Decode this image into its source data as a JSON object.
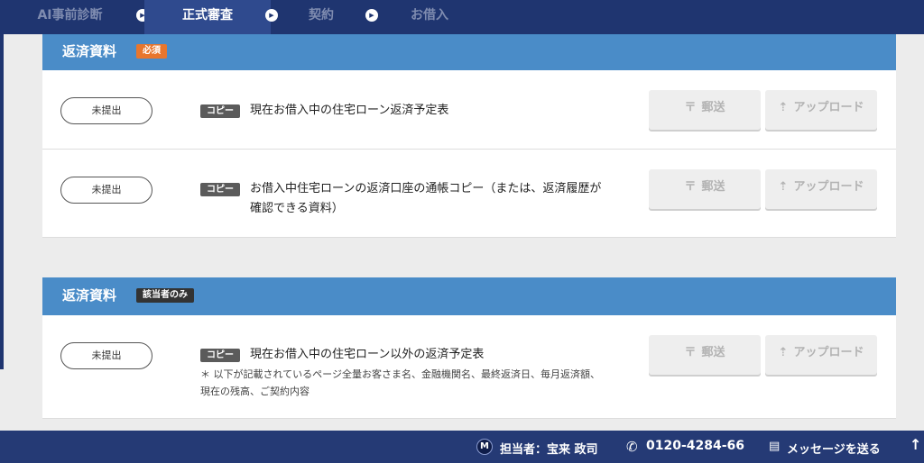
{
  "steps": [
    {
      "label": "AI事前診断"
    },
    {
      "label": "正式審査"
    },
    {
      "label": "契約"
    },
    {
      "label": "お借入"
    }
  ],
  "active_step": "正式審査",
  "panels": [
    {
      "title": "返済資料",
      "badge": "必須",
      "rows": [
        {
          "status": "未提出",
          "tag": "コピー",
          "title": "現在お借入中の住宅ローン返済予定表",
          "mail_label": "郵送",
          "upload_label": "アップロード"
        },
        {
          "status": "未提出",
          "tag": "コピー",
          "title": "お借入中住宅ローンの返済口座の通帳コピー（または、返済履歴が確認できる資料）",
          "mail_label": "郵送",
          "upload_label": "アップロード"
        }
      ]
    },
    {
      "title": "返済資料",
      "badge": "該当者のみ",
      "rows": [
        {
          "status": "未提出",
          "tag": "コピー",
          "title": "現在お借入中の住宅ローン以外の返済予定表",
          "note": "＊ 以下が記載されているページ全量お客さま名、金融機関名、最終返済日、毎月返済額、現在の残高、ご契約内容",
          "mail_label": "郵送",
          "upload_label": "アップロード"
        }
      ]
    }
  ],
  "footer": {
    "staff_logo": "M",
    "staff_label": "担当者：宝来 政司",
    "phone": "0120-4284-66",
    "message_label": "メッセージを送る"
  },
  "colors": {
    "navy": "#1f3570",
    "panel_header": "#4a8cc8",
    "required_badge": "#e8762d",
    "applicable_badge": "#333333"
  }
}
